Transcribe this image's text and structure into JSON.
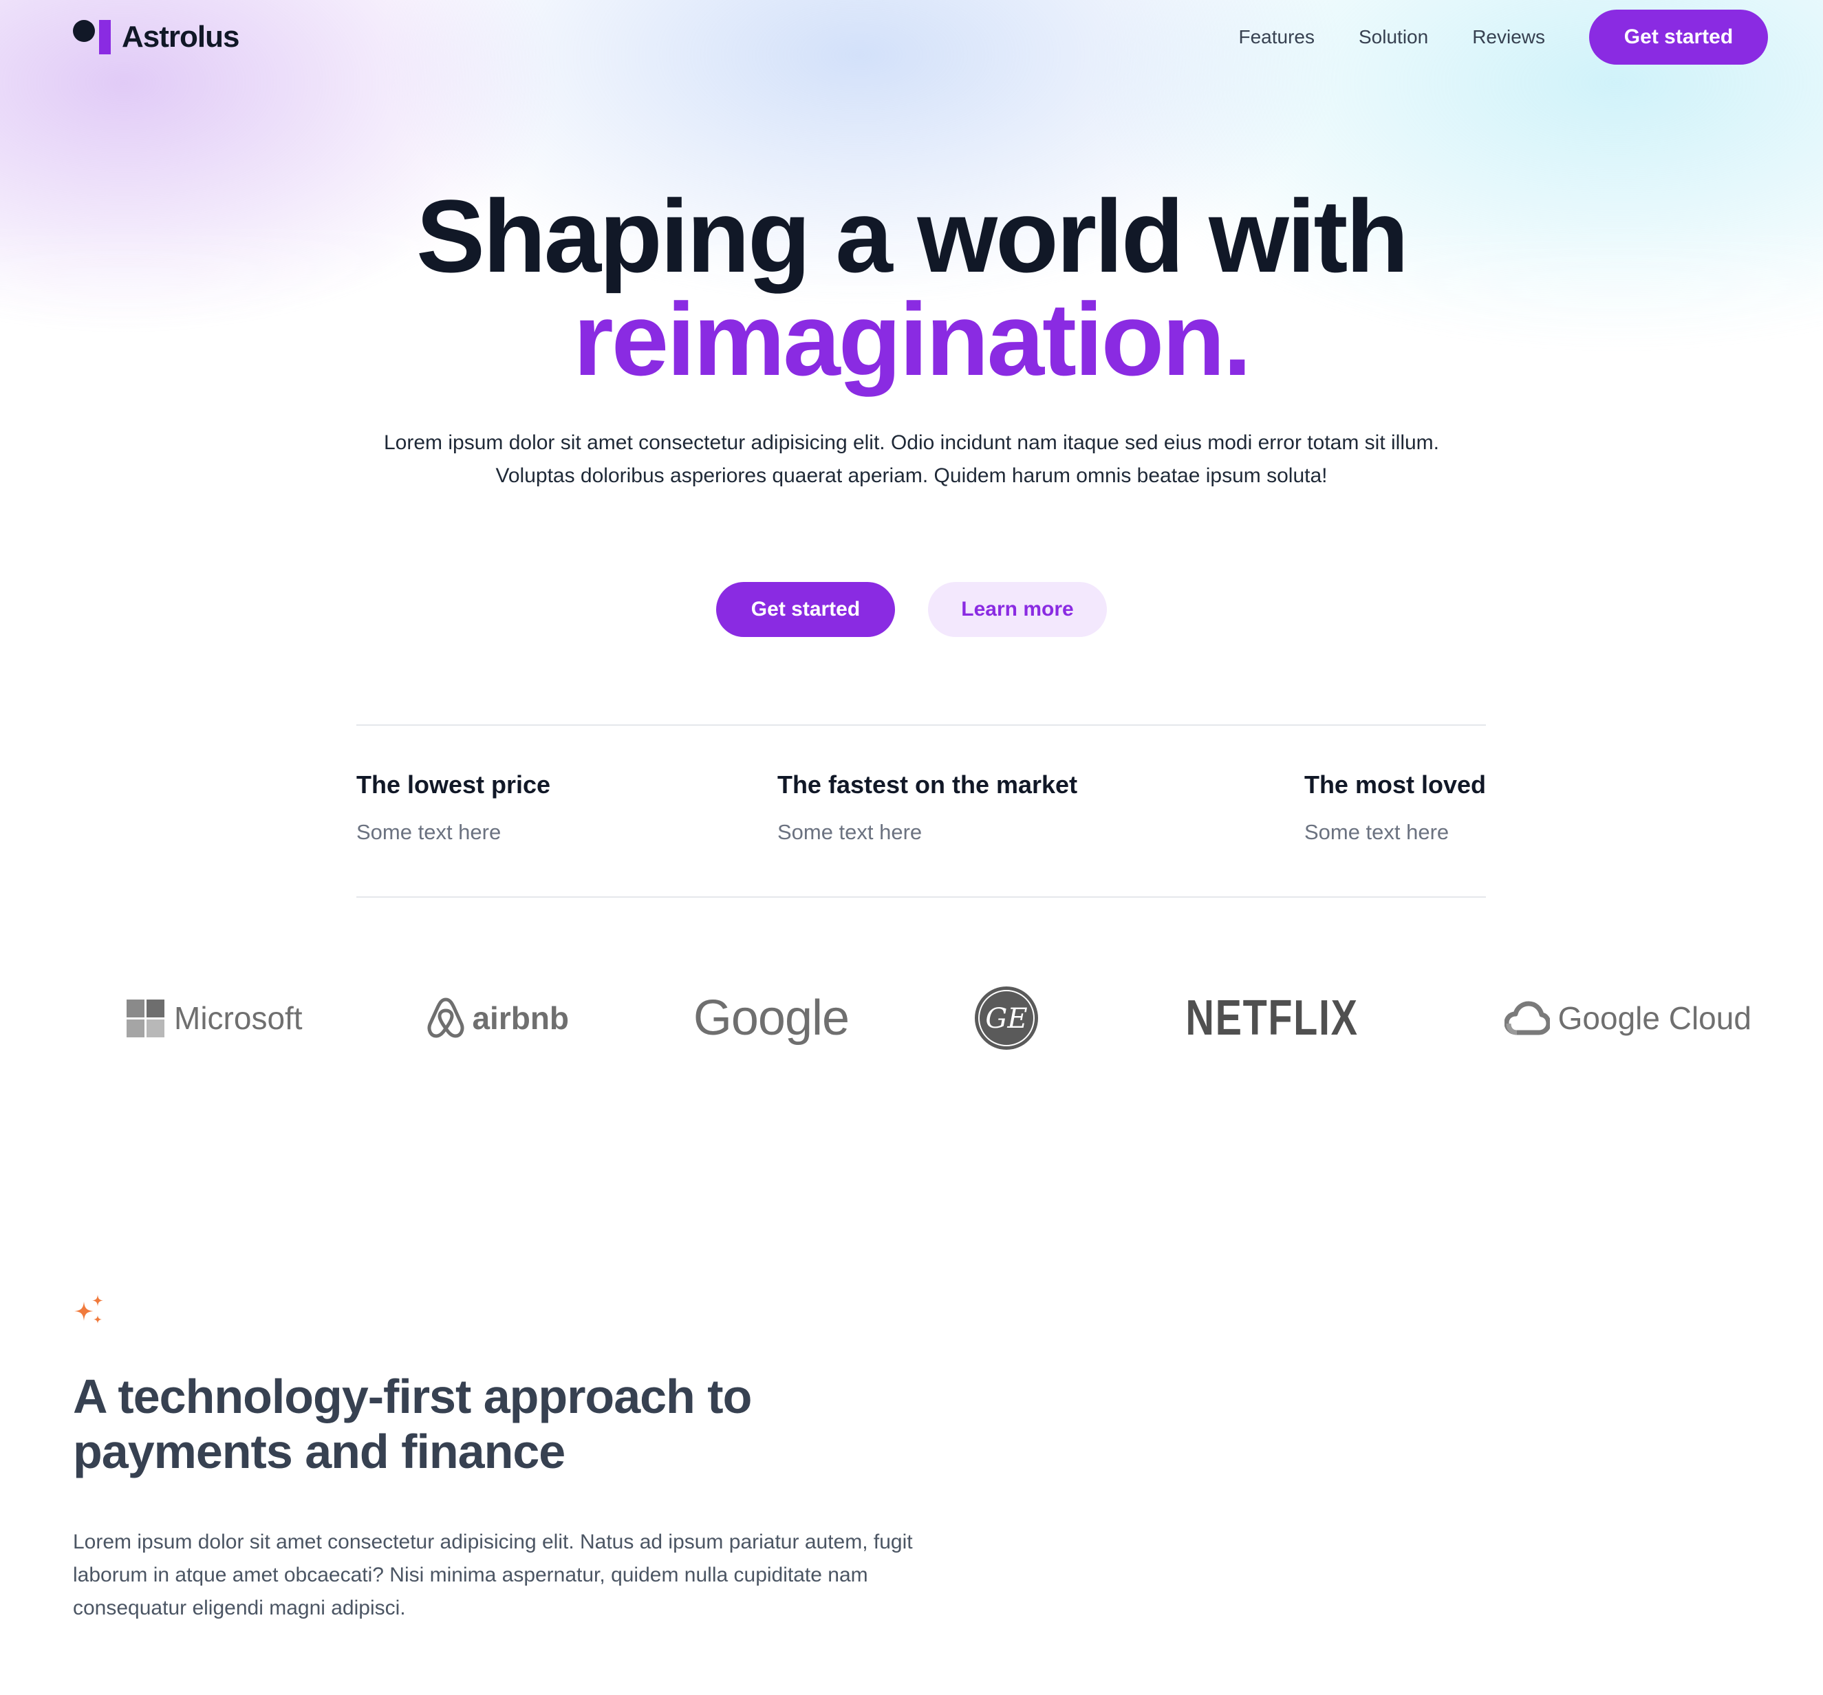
{
  "nav": {
    "logo_text": "Astrolus",
    "links": [
      "Features",
      "Solution",
      "Reviews"
    ],
    "cta_label": "Get started"
  },
  "hero": {
    "title_line1": "Shaping a world with",
    "title_line2": "reimagination.",
    "subtitle_line1": "Lorem ipsum dolor sit amet consectetur adipisicing elit. Odio incidunt nam itaque sed eius modi error totam sit illum.",
    "subtitle_line2": "Voluptas doloribus asperiores quaerat aperiam. Quidem harum omnis beatae ipsum soluta!",
    "primary_cta": "Get started",
    "secondary_cta": "Learn more"
  },
  "stats": [
    {
      "title": "The lowest price",
      "text": "Some text here"
    },
    {
      "title": "The fastest on the market",
      "text": "Some text here"
    },
    {
      "title": "The most loved",
      "text": "Some text here"
    }
  ],
  "logos": {
    "microsoft": "Microsoft",
    "airbnb": "airbnb",
    "google": "Google",
    "ge": "GE",
    "netflix": "NETFLIX",
    "google_cloud": "Google Cloud"
  },
  "feature": {
    "icon": "sparkle-icon",
    "title": "A technology-first approach to payments and finance",
    "text": "Lorem ipsum dolor sit amet consectetur adipisicing elit. Natus ad ipsum pariatur autem, fugit laborum in atque amet obcaecati? Nisi minima aspernatur, quidem nulla cupiditate nam consequatur eligendi magni adipisci."
  },
  "colors": {
    "accent": "#8A2BE2",
    "accent_soft": "#F3E8FD",
    "text_dark": "#111827",
    "sparkle": "#F07A3C"
  }
}
